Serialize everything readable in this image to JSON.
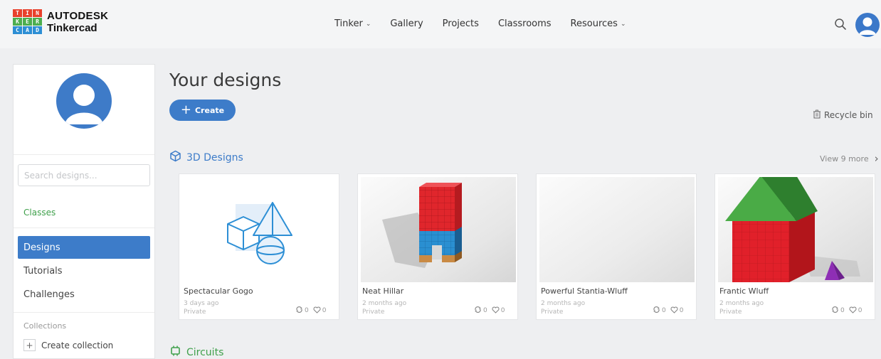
{
  "brand": {
    "logo_letters": [
      "T",
      "I",
      "N",
      "K",
      "E",
      "R",
      "C",
      "A",
      "D"
    ],
    "logo_colors": [
      "#e8412c",
      "#e8412c",
      "#e8412c",
      "#4cae4f",
      "#4cae4f",
      "#4cae4f",
      "#2d8fd5",
      "#2d8fd5",
      "#2d8fd5"
    ],
    "line1": "AUTODESK",
    "line2": "Tinkercad"
  },
  "nav": {
    "items": [
      {
        "label": "Tinker",
        "chevron": true
      },
      {
        "label": "Gallery",
        "chevron": false
      },
      {
        "label": "Projects",
        "chevron": false
      },
      {
        "label": "Classrooms",
        "chevron": false
      },
      {
        "label": "Resources",
        "chevron": true
      }
    ],
    "chevron_glyph": "⌄"
  },
  "sidebar": {
    "search_placeholder": "Search designs...",
    "classes_label": "Classes",
    "menu": [
      {
        "label": "Designs",
        "active": true
      },
      {
        "label": "Tutorials",
        "active": false
      },
      {
        "label": "Challenges",
        "active": false
      }
    ],
    "collections_label": "Collections",
    "create_collection_label": "Create collection",
    "plus_glyph": "+"
  },
  "main": {
    "title": "Your designs",
    "create_label": "Create",
    "create_plus": "+",
    "recycle_label": "Recycle bin",
    "section_3d_label": "3D Designs",
    "view_more_label": "View 9 more",
    "view_more_arrow": "›",
    "section_circuits_label": "Circuits"
  },
  "designs": [
    {
      "name": "Spectacular Gogo",
      "time": "3 days ago",
      "privacy": "Private",
      "tinkers": "0",
      "likes": "0"
    },
    {
      "name": "Neat Hillar",
      "time": "2 months ago",
      "privacy": "Private",
      "tinkers": "0",
      "likes": "0"
    },
    {
      "name": "Powerful Stantia-Wluff",
      "time": "2 months ago",
      "privacy": "Private",
      "tinkers": "0",
      "likes": "0"
    },
    {
      "name": "Frantic Wluff",
      "time": "2 months ago",
      "privacy": "Private",
      "tinkers": "0",
      "likes": "0"
    }
  ],
  "colors": {
    "accent_blue": "#3d7cc9",
    "accent_green": "#3fa04b"
  }
}
